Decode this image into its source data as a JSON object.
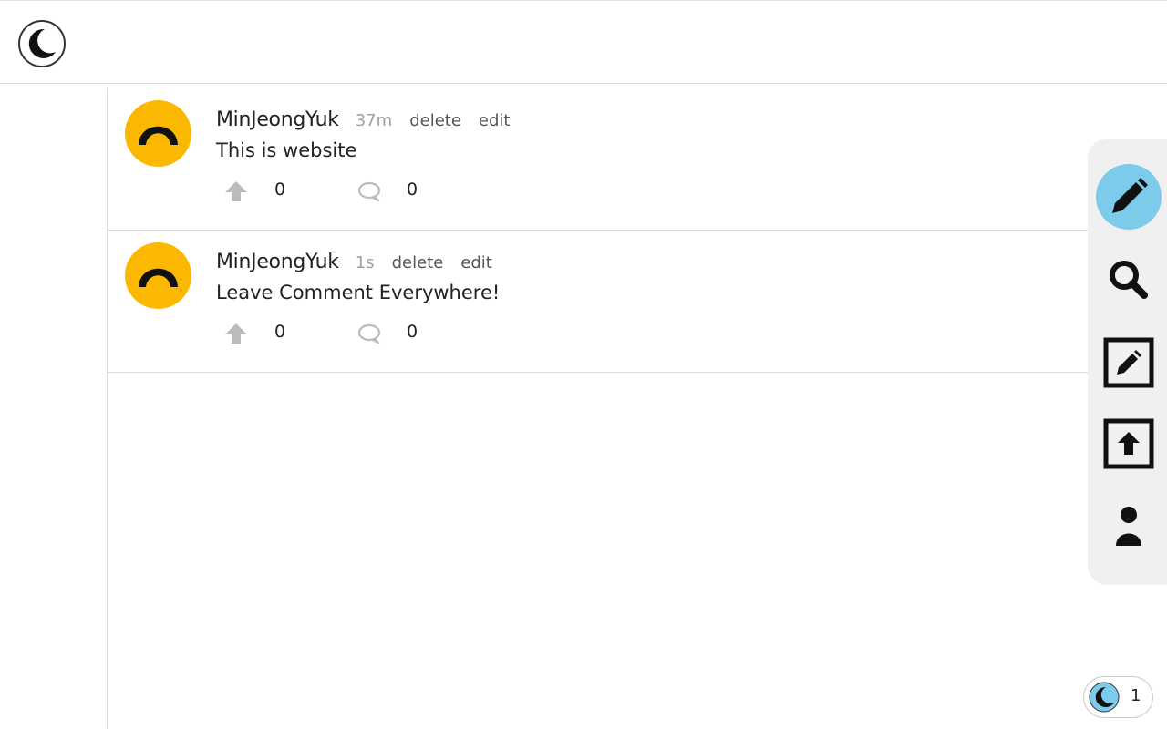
{
  "header": {
    "logo_icon": "moon-icon"
  },
  "posts": [
    {
      "author": "MinJeongYuk",
      "time": "37m",
      "delete_label": "delete",
      "edit_label": "edit",
      "body": "This is website",
      "upvotes": "0",
      "comments": "0",
      "avatar_icon": "avatar-arc-icon"
    },
    {
      "author": "MinJeongYuk",
      "time": "1s",
      "delete_label": "delete",
      "edit_label": "edit",
      "body": "Leave Comment Everywhere!",
      "upvotes": "0",
      "comments": "0",
      "avatar_icon": "avatar-arc-icon"
    }
  ],
  "sidebar": {
    "items": [
      {
        "icon": "pencil-icon",
        "active": true
      },
      {
        "icon": "search-icon",
        "active": false
      },
      {
        "icon": "edit-square-icon",
        "active": false
      },
      {
        "icon": "upload-icon",
        "active": false
      },
      {
        "icon": "user-icon",
        "active": false
      }
    ]
  },
  "badge": {
    "icon": "moon-icon",
    "count": "1"
  },
  "colors": {
    "avatar_bg": "#FBB800",
    "active_accent": "#7DCBEB",
    "sidebar_bg": "#F0F0F0",
    "muted_icon": "#BBBBBB"
  }
}
